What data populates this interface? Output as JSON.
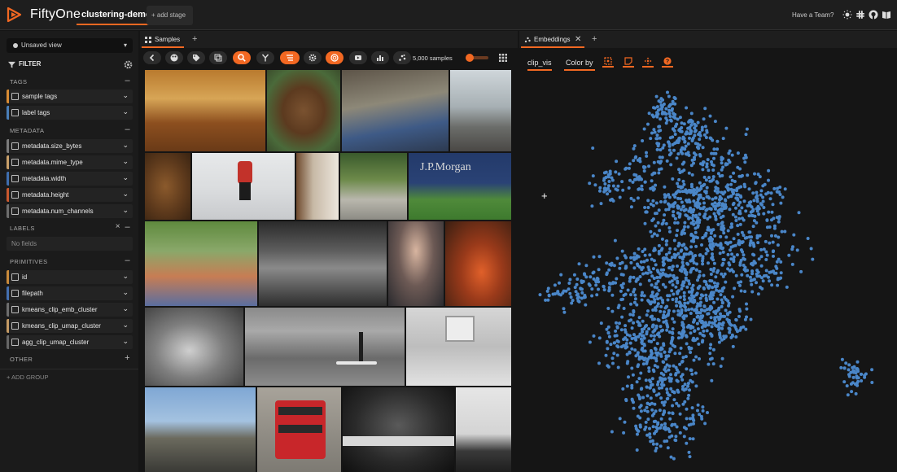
{
  "header": {
    "brand": "FiftyOne",
    "dataset": "clustering-demo",
    "add_stage": "+ add stage",
    "team_link": "Have a Team?",
    "icons": [
      "sun-icon",
      "slack-icon",
      "github-icon",
      "docs-icon"
    ],
    "accent_color": "#f26822"
  },
  "sidebar": {
    "view": "Unsaved view",
    "filter_label": "FILTER",
    "sections": {
      "tags": "TAGS",
      "metadata": "METADATA",
      "labels": "LABELS",
      "primitives": "PRIMITIVES",
      "other": "OTHER"
    },
    "tags": [
      {
        "name": "sample tags",
        "color": "#d98c34"
      },
      {
        "name": "label tags",
        "color": "#4a7fb8"
      }
    ],
    "metadata": [
      {
        "name": "metadata.size_bytes",
        "color": "#7c7c7c"
      },
      {
        "name": "metadata.mime_type",
        "color": "#c9a06a"
      },
      {
        "name": "metadata.width",
        "color": "#3f6fb0"
      },
      {
        "name": "metadata.height",
        "color": "#c9582e"
      },
      {
        "name": "metadata.num_channels",
        "color": "#6d6d6d"
      }
    ],
    "labels_empty": "No fields",
    "primitives": [
      {
        "name": "id",
        "color": "#c98a3a"
      },
      {
        "name": "filepath",
        "color": "#4470b0"
      },
      {
        "name": "kmeans_clip_emb_cluster",
        "color": "#6e6e6e"
      },
      {
        "name": "kmeans_clip_umap_cluster",
        "color": "#c49a64"
      },
      {
        "name": "agg_clip_umap_cluster",
        "color": "#666666"
      }
    ],
    "add_group": "+ ADD GROUP"
  },
  "samples_panel": {
    "tab": "Samples",
    "count": "5,000 samples"
  },
  "embeddings_panel": {
    "tab": "Embeddings",
    "brain_key": "clip_vis",
    "color_by": "Color by",
    "point_color": "#4a86c8"
  }
}
